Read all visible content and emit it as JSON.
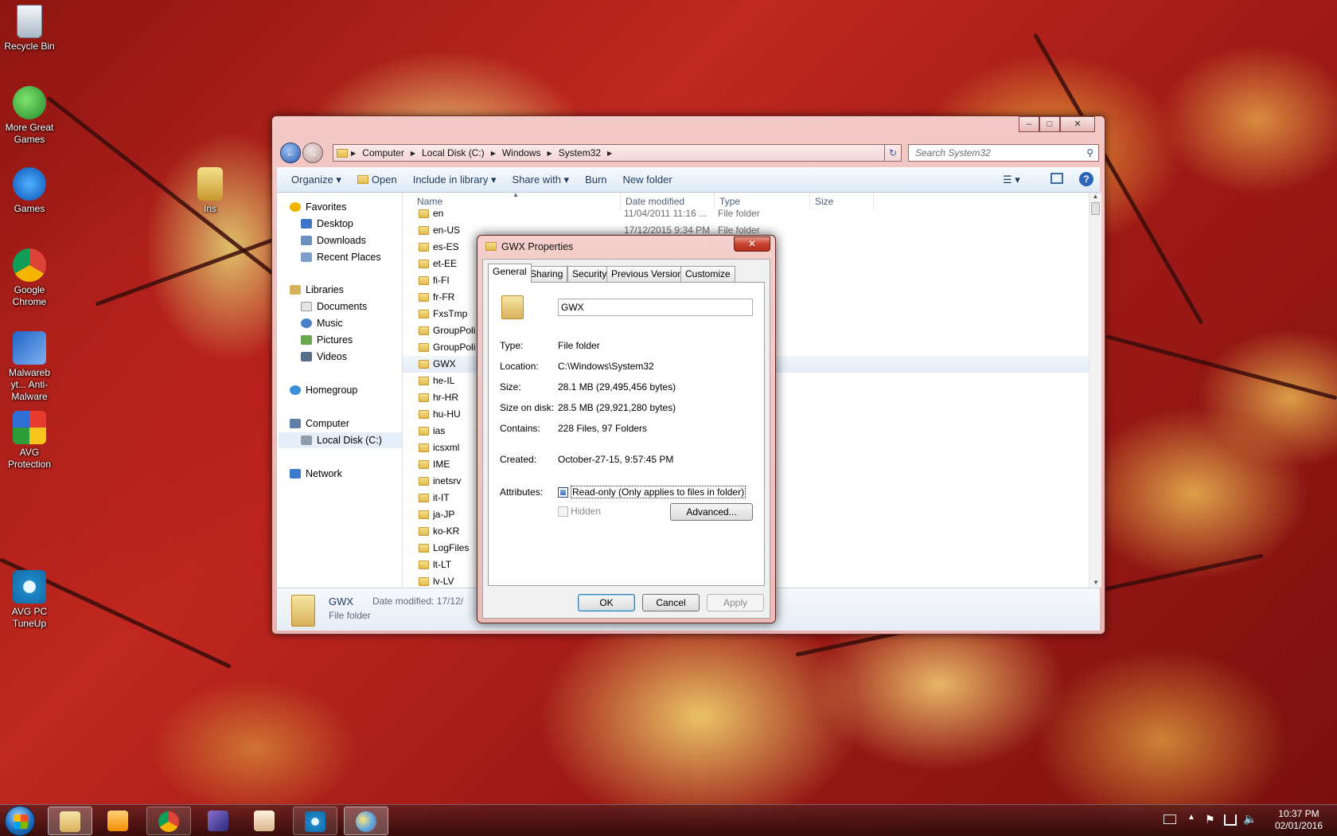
{
  "desktop": {
    "icons": [
      {
        "label": "Recycle Bin"
      },
      {
        "label": "More Great Games"
      },
      {
        "label": "Games"
      },
      {
        "label": "Google Chrome"
      },
      {
        "label": "Malwareb yt... Anti-Malware"
      },
      {
        "label": "AVG Protection"
      },
      {
        "label": "AVG PC TuneUp"
      }
    ],
    "partial_icon_label": "Ins"
  },
  "explorer": {
    "breadcrumb": [
      "Computer",
      "Local Disk (C:)",
      "Windows",
      "System32"
    ],
    "search_placeholder": "Search System32",
    "toolbar": {
      "organize": "Organize",
      "open": "Open",
      "include_in_library": "Include in library",
      "share_with": "Share with",
      "burn": "Burn",
      "new_folder": "New folder"
    },
    "nav": {
      "favorites": "Favorites",
      "desktop": "Desktop",
      "downloads": "Downloads",
      "recent_places": "Recent Places",
      "libraries": "Libraries",
      "documents": "Documents",
      "music": "Music",
      "pictures": "Pictures",
      "videos": "Videos",
      "homegroup": "Homegroup",
      "computer": "Computer",
      "local_disk": "Local Disk (C:)",
      "network": "Network"
    },
    "columns": {
      "name": "Name",
      "date_modified": "Date modified",
      "type": "Type",
      "size": "Size"
    },
    "files": [
      {
        "name": "en",
        "date": "11/04/2011 11:16 ...",
        "type": "File folder"
      },
      {
        "name": "en-US",
        "date": "17/12/2015 9:34 PM",
        "type": "File folder"
      },
      {
        "name": "es-ES",
        "date": "",
        "type": ""
      },
      {
        "name": "et-EE",
        "date": "",
        "type": ""
      },
      {
        "name": "fi-FI",
        "date": "",
        "type": ""
      },
      {
        "name": "fr-FR",
        "date": "",
        "type": ""
      },
      {
        "name": "FxsTmp",
        "date": "",
        "type": ""
      },
      {
        "name": "GroupPoli",
        "date": "",
        "type": ""
      },
      {
        "name": "GroupPoli",
        "date": "",
        "type": ""
      },
      {
        "name": "GWX",
        "date": "",
        "type": ""
      },
      {
        "name": "he-IL",
        "date": "",
        "type": ""
      },
      {
        "name": "hr-HR",
        "date": "",
        "type": ""
      },
      {
        "name": "hu-HU",
        "date": "",
        "type": ""
      },
      {
        "name": "ias",
        "date": "",
        "type": ""
      },
      {
        "name": "icsxml",
        "date": "",
        "type": ""
      },
      {
        "name": "IME",
        "date": "",
        "type": ""
      },
      {
        "name": "inetsrv",
        "date": "",
        "type": ""
      },
      {
        "name": "it-IT",
        "date": "",
        "type": ""
      },
      {
        "name": "ja-JP",
        "date": "",
        "type": ""
      },
      {
        "name": "ko-KR",
        "date": "",
        "type": ""
      },
      {
        "name": "LogFiles",
        "date": "",
        "type": ""
      },
      {
        "name": "lt-LT",
        "date": "",
        "type": ""
      },
      {
        "name": "lv-LV",
        "date": "",
        "type": ""
      }
    ],
    "details": {
      "name": "GWX",
      "type": "File folder",
      "date_label": "Date modified: 17/12/"
    }
  },
  "dialog": {
    "title": "GWX Properties",
    "tabs": [
      "General",
      "Sharing",
      "Security",
      "Previous Versions",
      "Customize"
    ],
    "folder_name": "GWX",
    "type_label": "Type:",
    "type_value": "File folder",
    "location_label": "Location:",
    "location_value": "C:\\Windows\\System32",
    "size_label": "Size:",
    "size_value": "28.1 MB (29,495,456 bytes)",
    "size_on_disk_label": "Size on disk:",
    "size_on_disk_value": "28.5 MB (29,921,280 bytes)",
    "contains_label": "Contains:",
    "contains_value": "228 Files, 97 Folders",
    "created_label": "Created:",
    "created_value": "October-27-15, 9:57:45 PM",
    "attributes_label": "Attributes:",
    "readonly_label": "Read-only (Only applies to files in folder)",
    "hidden_label": "Hidden",
    "advanced_button": "Advanced...",
    "ok_button": "OK",
    "cancel_button": "Cancel",
    "apply_button": "Apply"
  },
  "taskbar": {
    "time": "10:37 PM",
    "date": "02/01/2016"
  }
}
